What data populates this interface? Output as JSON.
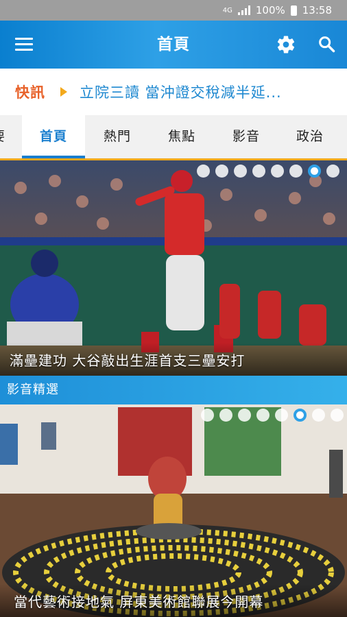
{
  "status_bar": {
    "network": "4G",
    "battery": "100%",
    "time": "13:58"
  },
  "app_bar": {
    "title": "首頁"
  },
  "ticker": {
    "label": "快訊",
    "headline": "立院三讀 當沖證交稅減半延..."
  },
  "tabs": [
    {
      "label": "首頁",
      "active": true
    },
    {
      "label": "熱門",
      "active": false
    },
    {
      "label": "焦點",
      "active": false
    },
    {
      "label": "影音",
      "active": false
    },
    {
      "label": "政治",
      "active": false
    }
  ],
  "tabs_partial_left": "要",
  "hero": {
    "caption": "滿壘建功 大谷敲出生涯首支三壘安打",
    "slide_count": 8,
    "active_slide": 7
  },
  "video_section": {
    "title": "影音精選",
    "caption": "當代藝術接地氣 屏東美術館聯展今開幕",
    "slide_count": 8,
    "active_slide": 6
  },
  "colors": {
    "accent": "#1a7fcf",
    "ticker_label": "#e8622a",
    "ticker_headline": "#1e88d0",
    "tab_underline": "#f3a91c"
  }
}
